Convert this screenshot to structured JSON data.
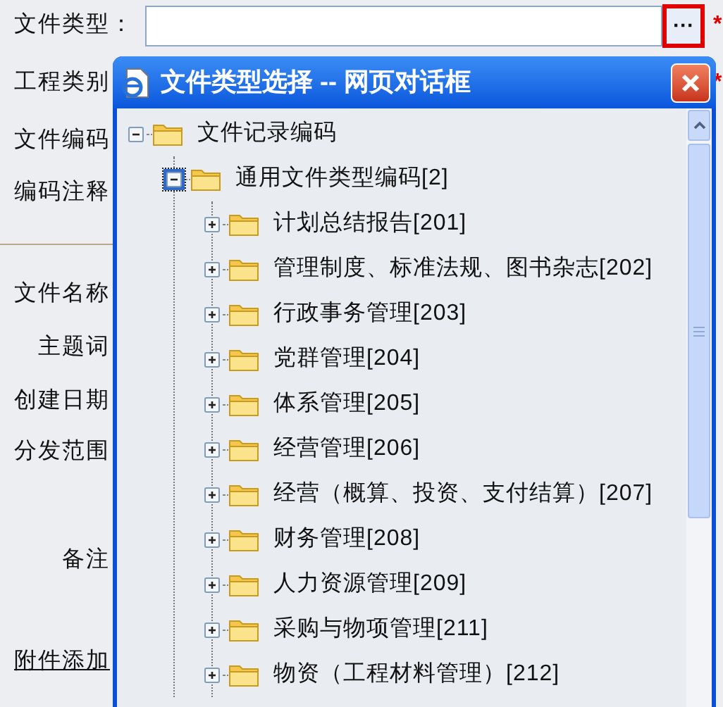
{
  "form": {
    "fields": [
      {
        "label": "文件类型：",
        "kind": "input",
        "required_mark": "*"
      },
      {
        "label": "工程类别",
        "kind": "label",
        "required_mark": "*"
      },
      {
        "label": "文件编码",
        "kind": "label"
      },
      {
        "label": "编码注释",
        "kind": "label"
      },
      {
        "kind": "separator"
      },
      {
        "label": "文件名称",
        "kind": "label"
      },
      {
        "label": "主题词",
        "kind": "label"
      },
      {
        "label": "创建日期",
        "kind": "label"
      },
      {
        "label": "分发范围",
        "kind": "label"
      },
      {
        "label": "备注",
        "kind": "tall"
      },
      {
        "label": "附件添加",
        "kind": "link"
      }
    ],
    "browse_button": "···"
  },
  "dialog": {
    "title": "文件类型选择 -- 网页对话框",
    "tree": [
      {
        "label": "文件记录编码",
        "expanded": true,
        "selected": false,
        "children": [
          {
            "label": "通用文件类型编码[2]",
            "expanded": true,
            "selected": true,
            "children": [
              {
                "label": "计划总结报告[201]",
                "expanded": false,
                "selected": false
              },
              {
                "label": "管理制度、标准法规、图书杂志[202]",
                "expanded": false,
                "selected": false
              },
              {
                "label": "行政事务管理[203]",
                "expanded": false,
                "selected": false
              },
              {
                "label": "党群管理[204]",
                "expanded": false,
                "selected": false
              },
              {
                "label": "体系管理[205]",
                "expanded": false,
                "selected": false
              },
              {
                "label": "经营管理[206]",
                "expanded": false,
                "selected": false
              },
              {
                "label": "经营（概算、投资、支付结算）[207]",
                "expanded": false,
                "selected": false
              },
              {
                "label": "财务管理[208]",
                "expanded": false,
                "selected": false
              },
              {
                "label": "人力资源管理[209]",
                "expanded": false,
                "selected": false
              },
              {
                "label": "采购与物项管理[211]",
                "expanded": false,
                "selected": false
              },
              {
                "label": "物资（工程材料管理）[212]",
                "expanded": false,
                "selected": false
              }
            ]
          }
        ]
      }
    ]
  }
}
